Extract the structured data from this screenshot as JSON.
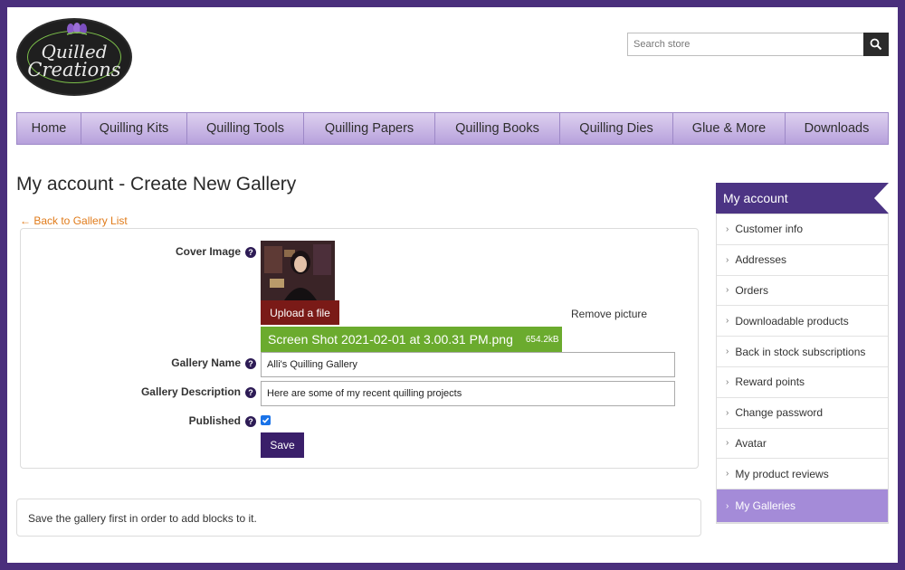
{
  "header": {
    "logo_line1": "Quilled",
    "logo_line2": "Creations",
    "search_placeholder": "Search store"
  },
  "nav": {
    "items": [
      "Home",
      "Quilling Kits",
      "Quilling Tools",
      "Quilling Papers",
      "Quilling Books",
      "Quilling Dies",
      "Glue & More",
      "Downloads"
    ]
  },
  "main": {
    "title": "My account - Create New Gallery",
    "back_link": "← Back to Gallery List",
    "form": {
      "cover_label": "Cover Image",
      "upload_label": "Upload a file",
      "remove_label": "Remove picture",
      "file_name": "Screen Shot 2021-02-01 at 3.00.31 PM.png",
      "file_size": "654.2kB",
      "name_label": "Gallery Name",
      "name_value": "Alli's Quilling Gallery",
      "desc_label": "Gallery Description",
      "desc_value": "Here are some of my recent quilling projects",
      "published_label": "Published",
      "published": true,
      "save_label": "Save",
      "help_glyph": "?"
    },
    "notice": "Save the gallery first in order to add blocks to it."
  },
  "sidebar": {
    "title": "My account",
    "items": [
      {
        "label": "Customer info"
      },
      {
        "label": "Addresses"
      },
      {
        "label": "Orders"
      },
      {
        "label": "Downloadable products"
      },
      {
        "label": "Back in stock subscriptions"
      },
      {
        "label": "Reward points"
      },
      {
        "label": "Change password"
      },
      {
        "label": "Avatar"
      },
      {
        "label": "My product reviews"
      },
      {
        "label": "My Galleries"
      }
    ],
    "active": "My Galleries"
  },
  "colors": {
    "brand_purple": "#4c3484",
    "nav_gradient_top": "#ddd0ef",
    "nav_gradient_bottom": "#b7a1dc",
    "upload_red": "#7a1a17",
    "file_green": "#6bab2e",
    "link_orange": "#e07b1a",
    "active_item": "#a48bd8"
  }
}
